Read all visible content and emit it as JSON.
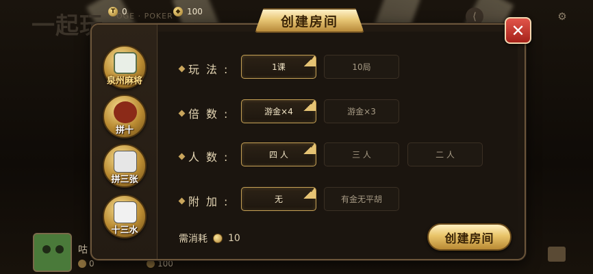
{
  "background": {
    "logo": "一起玩",
    "subtitle": "OGE · POKER",
    "resources": {
      "cards": "0",
      "diamonds": "100"
    },
    "player": {
      "name": "咕",
      "cards": "0",
      "diamonds": "100"
    }
  },
  "dialog": {
    "title": "创建房间",
    "close_label": "✕",
    "games": [
      {
        "label": "泉州麻将",
        "selected": true
      },
      {
        "label": "拼十",
        "selected": false
      },
      {
        "label": "拼三张",
        "selected": false
      },
      {
        "label": "十三水",
        "selected": false
      }
    ],
    "rows": [
      {
        "label": "玩法:",
        "options": [
          "1课",
          "10局"
        ],
        "selected": 0
      },
      {
        "label": "倍数:",
        "options": [
          "游金×4",
          "游金×3"
        ],
        "selected": 0
      },
      {
        "label": "人数:",
        "options": [
          "四 人",
          "三 人",
          "二 人"
        ],
        "selected": 0
      },
      {
        "label": "附加:",
        "options": [
          "无",
          "有金无平胡"
        ],
        "selected": 0
      }
    ],
    "cost_label": "需消耗",
    "cost_value": "10",
    "create_button": "创建房间"
  },
  "colors": {
    "accent_gold": "#c7a256",
    "close_red": "#c53a2f"
  },
  "icons": [
    "card-icon",
    "diamond-icon",
    "share-icon",
    "user-icon",
    "gear-icon",
    "close-icon",
    "mail-icon"
  ]
}
